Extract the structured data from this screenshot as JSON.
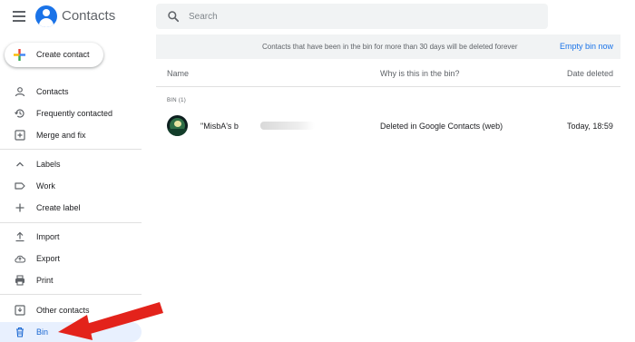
{
  "header": {
    "app_title": "Contacts",
    "search_placeholder": "Search"
  },
  "sidebar": {
    "create_label": "Create contact",
    "items": [
      {
        "label": "Contacts",
        "icon": "person-icon"
      },
      {
        "label": "Frequently contacted",
        "icon": "history-icon"
      },
      {
        "label": "Merge and fix",
        "icon": "merge-icon"
      },
      {
        "label": "Labels",
        "icon": "chevron-up-icon"
      },
      {
        "label": "Work",
        "icon": "label-icon"
      },
      {
        "label": "Create label",
        "icon": "plus-icon"
      },
      {
        "label": "Import",
        "icon": "upload-icon"
      },
      {
        "label": "Export",
        "icon": "cloud-icon"
      },
      {
        "label": "Print",
        "icon": "printer-icon"
      },
      {
        "label": "Other contacts",
        "icon": "inbox-icon"
      },
      {
        "label": "Bin",
        "icon": "trash-icon",
        "active": true
      }
    ]
  },
  "banner": {
    "message": "Contacts that have been in the bin for more than 30 days will be deleted forever",
    "action_label": "Empty bin now"
  },
  "table": {
    "columns": [
      "Name",
      "Why is this in the bin?",
      "Date deleted"
    ],
    "section_label": "BIN (1)",
    "rows": [
      {
        "name": "\"MisbA's b",
        "reason": "Deleted in Google Contacts (web)",
        "date": "Today, 18:59"
      }
    ]
  },
  "colors": {
    "accent": "#1a73e8",
    "active_bg": "#e8f0fe",
    "annotation_arrow": "#e3231b"
  }
}
